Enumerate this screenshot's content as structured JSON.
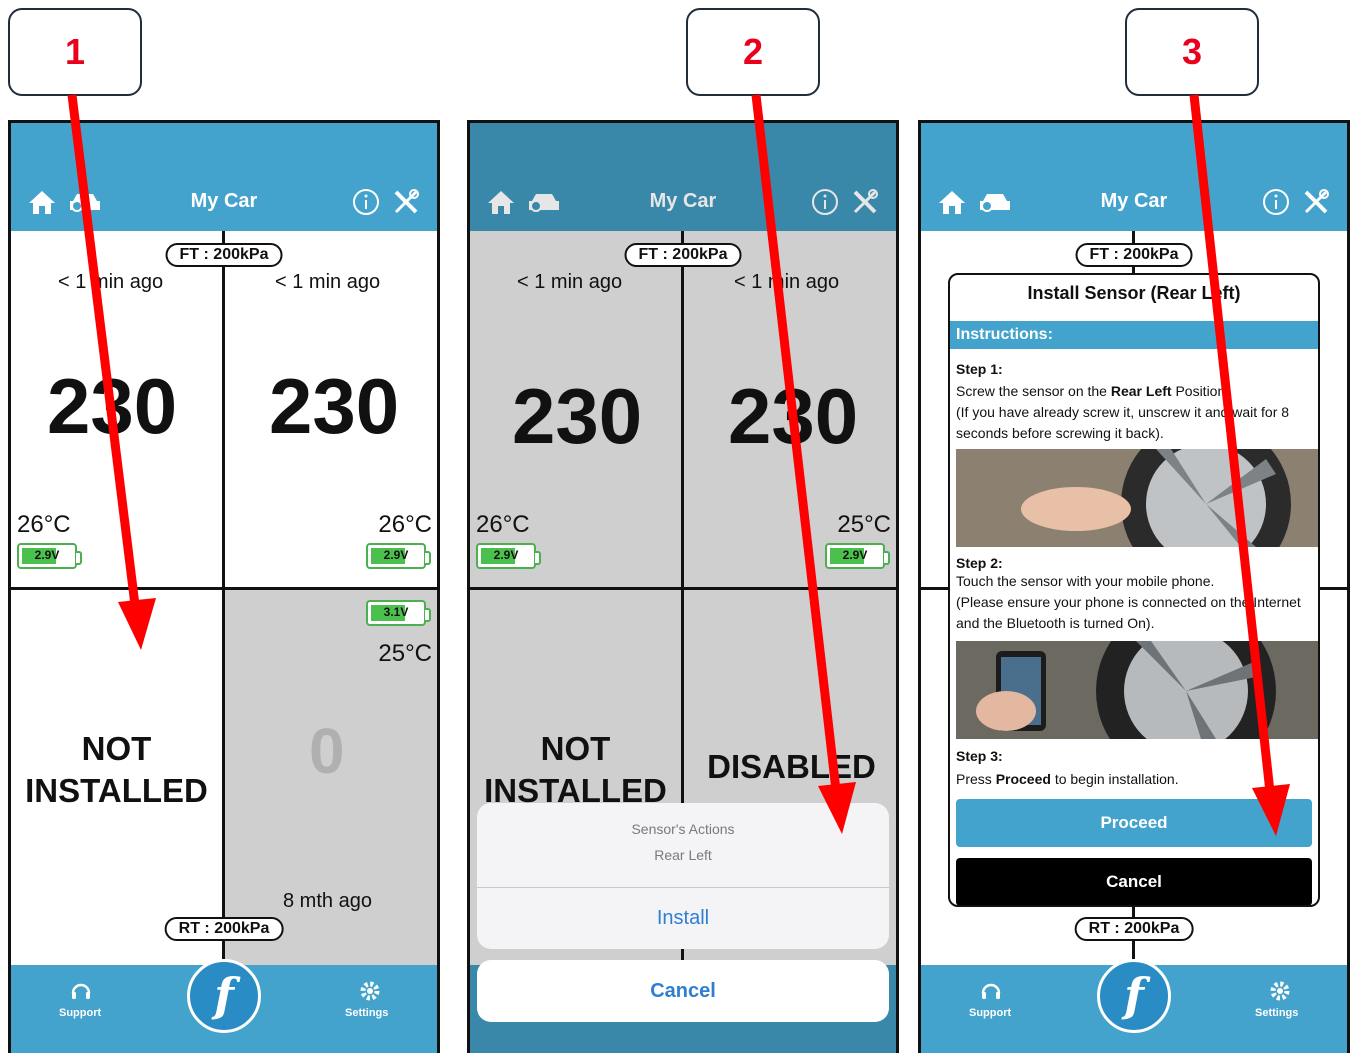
{
  "steps": [
    "1",
    "2",
    "3"
  ],
  "app": {
    "title": "My Car",
    "front_pill": "FT : 200kPa",
    "rear_pill": "RT : 200kPa",
    "support_label": "Support",
    "settings_label": "Settings",
    "logo_letter": "f"
  },
  "screen1": {
    "fl": {
      "ago": "< 1 min ago",
      "pressure": "230",
      "temp": "26°C",
      "battery": "2.9V"
    },
    "fr": {
      "ago": "< 1 min ago",
      "pressure": "230",
      "temp": "26°C",
      "battery": "2.9V"
    },
    "rl": {
      "status_line1": "NOT",
      "status_line2": "INSTALLED"
    },
    "rr": {
      "battery": "3.1V",
      "temp": "25°C",
      "pressure": "0",
      "ago": "8 mth ago"
    }
  },
  "screen2": {
    "fl": {
      "ago": "< 1 min ago",
      "pressure": "230",
      "temp": "26°C",
      "battery": "2.9V"
    },
    "fr": {
      "ago": "< 1 min ago",
      "pressure": "230",
      "temp": "25°C",
      "battery": "2.9V"
    },
    "rl": {
      "status_line1": "NOT",
      "status_line2": "INSTALLED"
    },
    "rr": {
      "status": "DISABLED"
    },
    "sheet": {
      "title": "Sensor's Actions",
      "subtitle": "Rear Left",
      "action": "Install",
      "cancel": "Cancel"
    }
  },
  "screen3": {
    "modal": {
      "title": "Install Sensor (Rear Left)",
      "instructions": "Instructions:",
      "step1_title": "Step 1:",
      "step1_pre": "Screw the sensor on the ",
      "step1_bold": "Rear Left",
      "step1_post": " Position.",
      "step1_note": "(If you have already screw it, unscrew it and wait for 8 seconds before screwing it back).",
      "step2_title": "Step 2:",
      "step2_text": "Touch the sensor with your mobile phone.",
      "step2_note": "(Please ensure your phone is connected on the Internet and the Bluetooth is turned On).",
      "step3_title": "Step 3:",
      "step3_pre": "Press ",
      "step3_bold": "Proceed",
      "step3_post": " to begin installation.",
      "proceed": "Proceed",
      "cancel": "Cancel"
    }
  },
  "colors": {
    "header": "#44a3cc",
    "arrow": "#ff0000",
    "step_number": "#e8001c",
    "battery": "#4cc04c"
  },
  "icons": [
    "home-icon",
    "car-icon",
    "info-icon",
    "tools-icon",
    "headset-icon",
    "gear-icon"
  ]
}
